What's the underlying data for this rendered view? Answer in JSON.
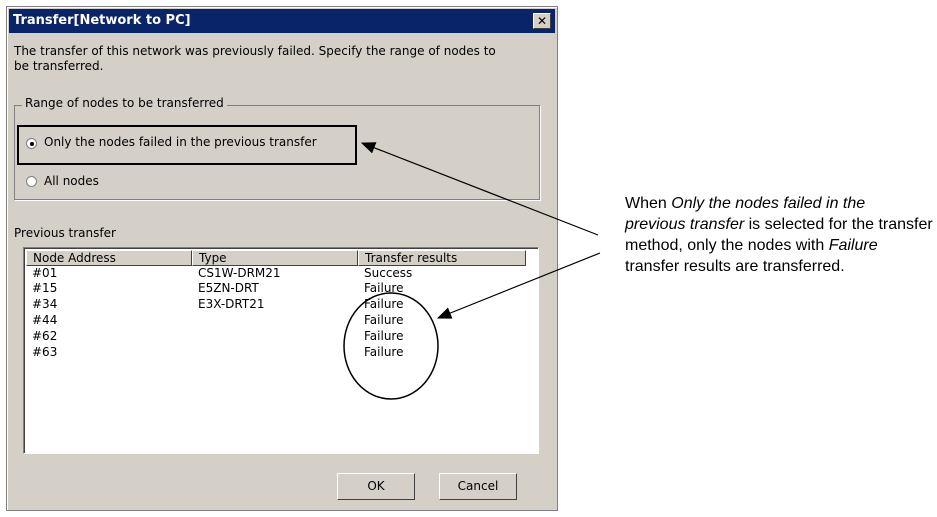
{
  "dialog": {
    "title": "Transfer[Network to PC]",
    "close_glyph": "✕",
    "message_line1": "The transfer of this network was previously failed. Specify the range of nodes to",
    "message_line2": "be transferred.",
    "range_group_label": "Range of nodes to be transferred",
    "radio_options": [
      {
        "label": "Only the nodes failed in the previous transfer",
        "selected": true
      },
      {
        "label": "All nodes",
        "selected": false
      }
    ],
    "previous_transfer_label": "Previous transfer",
    "columns": [
      "Node Address",
      "Type",
      "Transfer results"
    ],
    "rows": [
      {
        "address": "#01",
        "type": "CS1W-DRM21",
        "result": "Success"
      },
      {
        "address": "#15",
        "type": "E5ZN-DRT",
        "result": "Failure"
      },
      {
        "address": "#34",
        "type": "E3X-DRT21",
        "result": "Failure"
      },
      {
        "address": "#44",
        "type": "",
        "result": "Failure"
      },
      {
        "address": "#62",
        "type": "",
        "result": "Failure"
      },
      {
        "address": "#63",
        "type": "",
        "result": "Failure"
      }
    ],
    "ok_label": "OK",
    "cancel_label": "Cancel"
  },
  "annotation": {
    "t1": "When ",
    "i1": "Only the nodes failed in the",
    "i2": "previous transfer",
    "t2": " is selected for the transfer method, only the nodes with ",
    "i3": "Failure",
    "t3": " transfer results are transferred."
  }
}
